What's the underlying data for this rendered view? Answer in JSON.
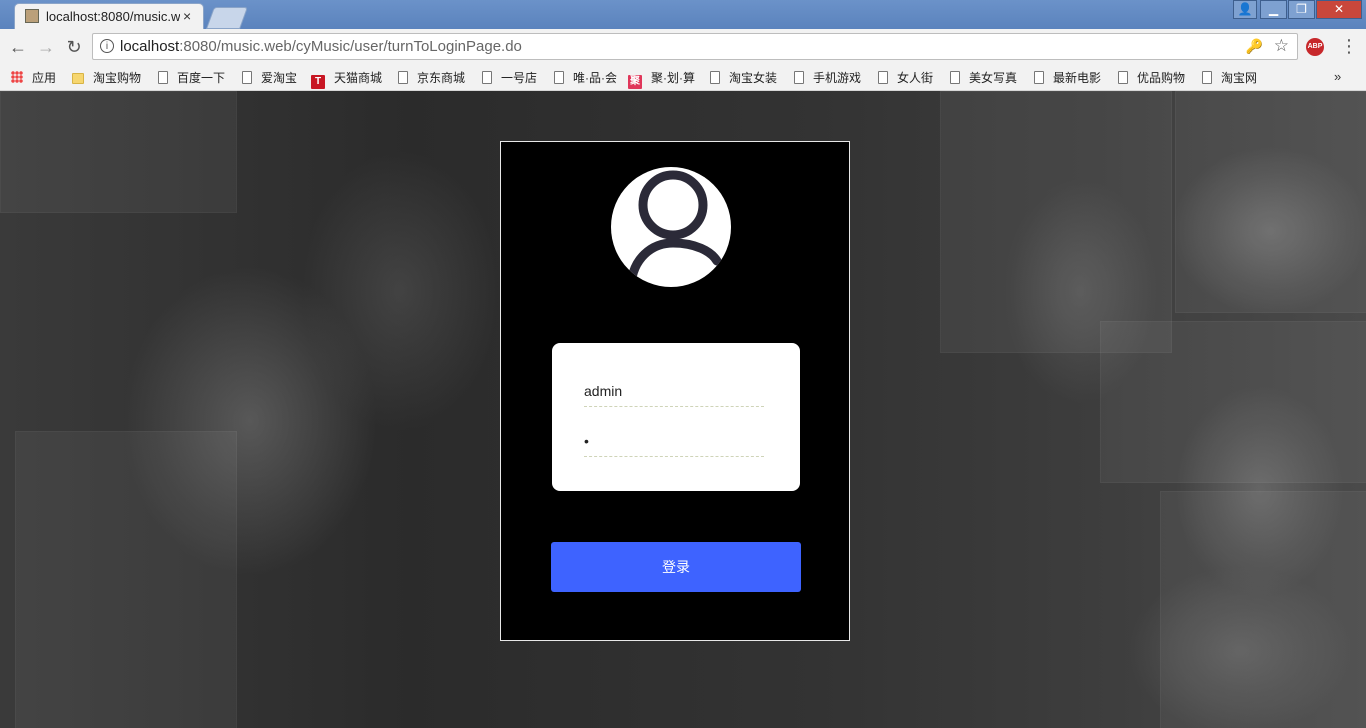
{
  "browser": {
    "tab_title": "localhost:8080/music.w",
    "tab_close": "×",
    "url_host": "localhost",
    "url_rest": ":8080/music.web/cyMusic/user/turnToLoginPage.do",
    "window_controls": {
      "close": "✕",
      "minimize": "▁",
      "maximize": "❐",
      "user": "👤"
    },
    "nav": {
      "back": "←",
      "forward": "→",
      "reload": "↻"
    },
    "abp_label": "ABP",
    "menu_icon": "⋮",
    "info_icon": "i",
    "star_icon": "☆",
    "key_icon": "🔑"
  },
  "bookmarks": [
    {
      "label": "应用",
      "icon": "apps-icon"
    },
    {
      "label": "淘宝购物",
      "icon": "folder-icon"
    },
    {
      "label": "百度一下",
      "icon": "page-icon"
    },
    {
      "label": "爱淘宝",
      "icon": "page-icon"
    },
    {
      "label": "天猫商城",
      "icon": "tmall-icon",
      "glyph": "T"
    },
    {
      "label": "京东商城",
      "icon": "page-icon"
    },
    {
      "label": "一号店",
      "icon": "page-icon"
    },
    {
      "label": "唯·品·会",
      "icon": "page-icon"
    },
    {
      "label": "聚·划·算",
      "icon": "ju-icon",
      "glyph": "聚"
    },
    {
      "label": "淘宝女装",
      "icon": "page-icon"
    },
    {
      "label": "手机游戏",
      "icon": "page-icon"
    },
    {
      "label": "女人街",
      "icon": "page-icon"
    },
    {
      "label": "美女写真",
      "icon": "page-icon"
    },
    {
      "label": "最新电影",
      "icon": "page-icon"
    },
    {
      "label": "优品购物",
      "icon": "page-icon"
    },
    {
      "label": "淘宝网",
      "icon": "page-icon"
    }
  ],
  "bookmarks_more": "»",
  "login": {
    "username_value": "admin",
    "password_value": "•",
    "submit_label": "登录",
    "colors": {
      "card": "#000000",
      "button": "#3e63ff",
      "form": "#ffffff"
    }
  }
}
